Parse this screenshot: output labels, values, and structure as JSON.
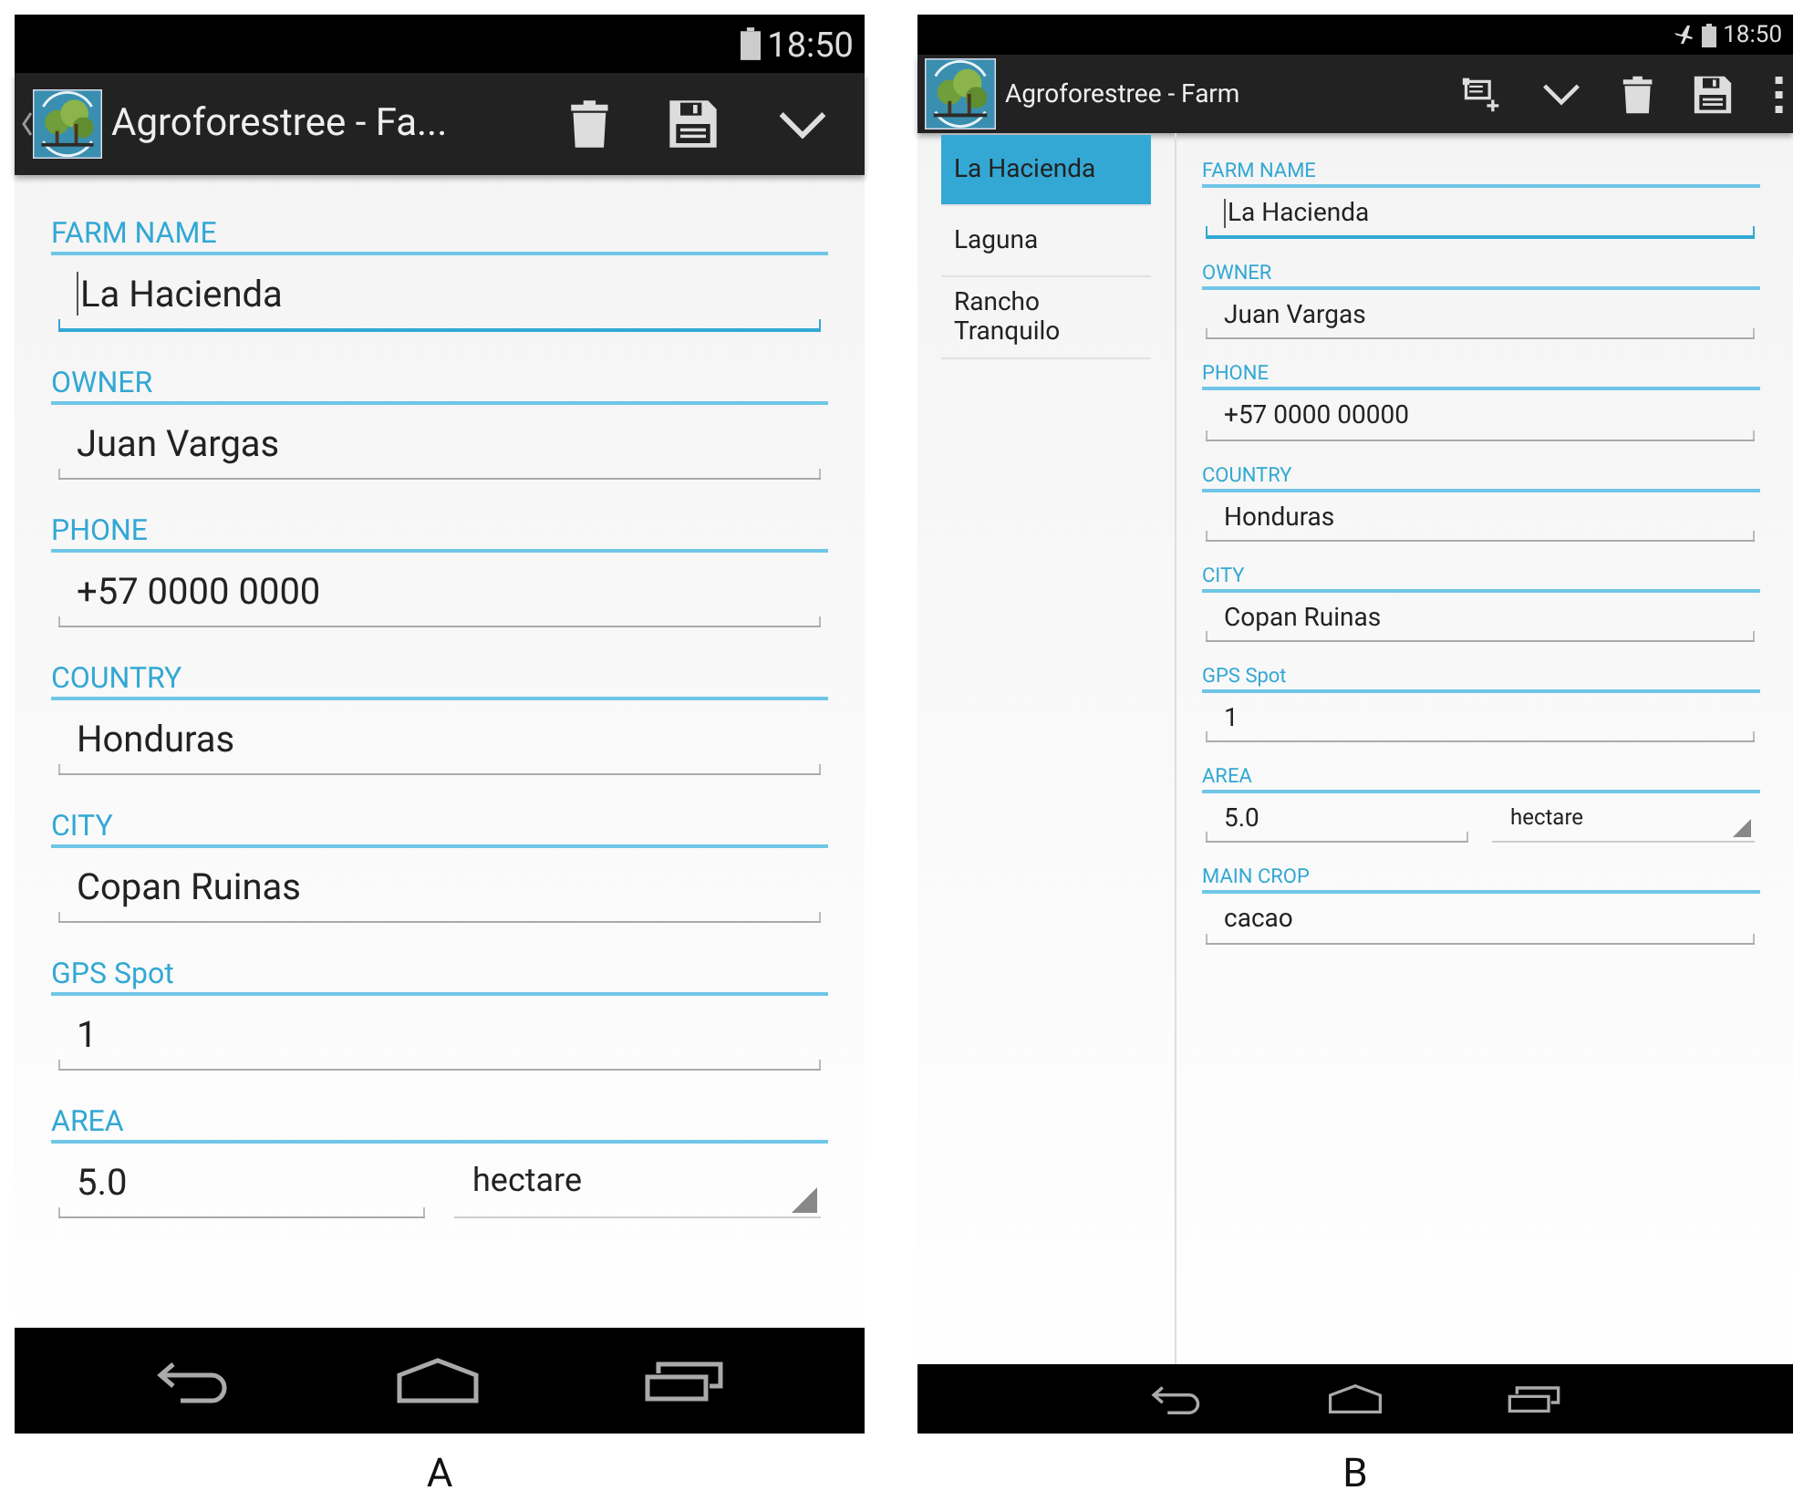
{
  "screens": [
    {
      "caption": "A",
      "kind": "phone",
      "status_bar": {
        "time": "18:50",
        "airplane": false
      },
      "action_bar": {
        "back": true,
        "title": "Agroforestree - Fa...",
        "actions": [
          {
            "kind": "delete"
          },
          {
            "kind": "save"
          },
          {
            "kind": "collapse"
          }
        ]
      },
      "form": [
        {
          "kind": "text",
          "label": "FARM NAME",
          "value": "La Hacienda",
          "focused": true
        },
        {
          "kind": "text",
          "label": "OWNER",
          "value": "Juan Vargas",
          "focused": false
        },
        {
          "kind": "text",
          "label": "PHONE",
          "value": "+57 0000 0000",
          "focused": false
        },
        {
          "kind": "text",
          "label": "COUNTRY",
          "value": "Honduras",
          "focused": false
        },
        {
          "kind": "text",
          "label": "CITY",
          "value": "Copan Ruinas",
          "focused": false
        },
        {
          "kind": "text",
          "label": "GPS Spot",
          "value": "1",
          "focused": false
        },
        {
          "kind": "area",
          "label": "AREA",
          "value": "5.0",
          "unit": "hectare",
          "focused": false
        }
      ]
    },
    {
      "caption": "B",
      "kind": "tablet",
      "status_bar": {
        "time": "18:50",
        "airplane": true
      },
      "action_bar": {
        "back": false,
        "title": "Agroforestree - Farm",
        "actions": [
          {
            "kind": "add"
          },
          {
            "kind": "collapse"
          },
          {
            "kind": "delete"
          },
          {
            "kind": "save"
          },
          {
            "kind": "more"
          }
        ]
      },
      "list": [
        {
          "label": "La Hacienda",
          "selected": true
        },
        {
          "label": "Laguna",
          "selected": false
        },
        {
          "label": "Rancho Tranquilo",
          "selected": false
        }
      ],
      "form": [
        {
          "kind": "text",
          "label": "FARM NAME",
          "value": "La Hacienda",
          "focused": true
        },
        {
          "kind": "text",
          "label": "OWNER",
          "value": "Juan Vargas",
          "focused": false
        },
        {
          "kind": "text",
          "label": "PHONE",
          "value": "+57 0000 00000",
          "focused": false
        },
        {
          "kind": "text",
          "label": "COUNTRY",
          "value": "Honduras",
          "focused": false
        },
        {
          "kind": "text",
          "label": "CITY",
          "value": "Copan Ruinas",
          "focused": false
        },
        {
          "kind": "text",
          "label": "GPS Spot",
          "value": "1",
          "focused": false
        },
        {
          "kind": "area",
          "label": "AREA",
          "value": "5.0",
          "unit": "hectare",
          "focused": false
        },
        {
          "kind": "text",
          "label": "MAIN CROP",
          "value": "cacao",
          "focused": false
        }
      ]
    }
  ]
}
